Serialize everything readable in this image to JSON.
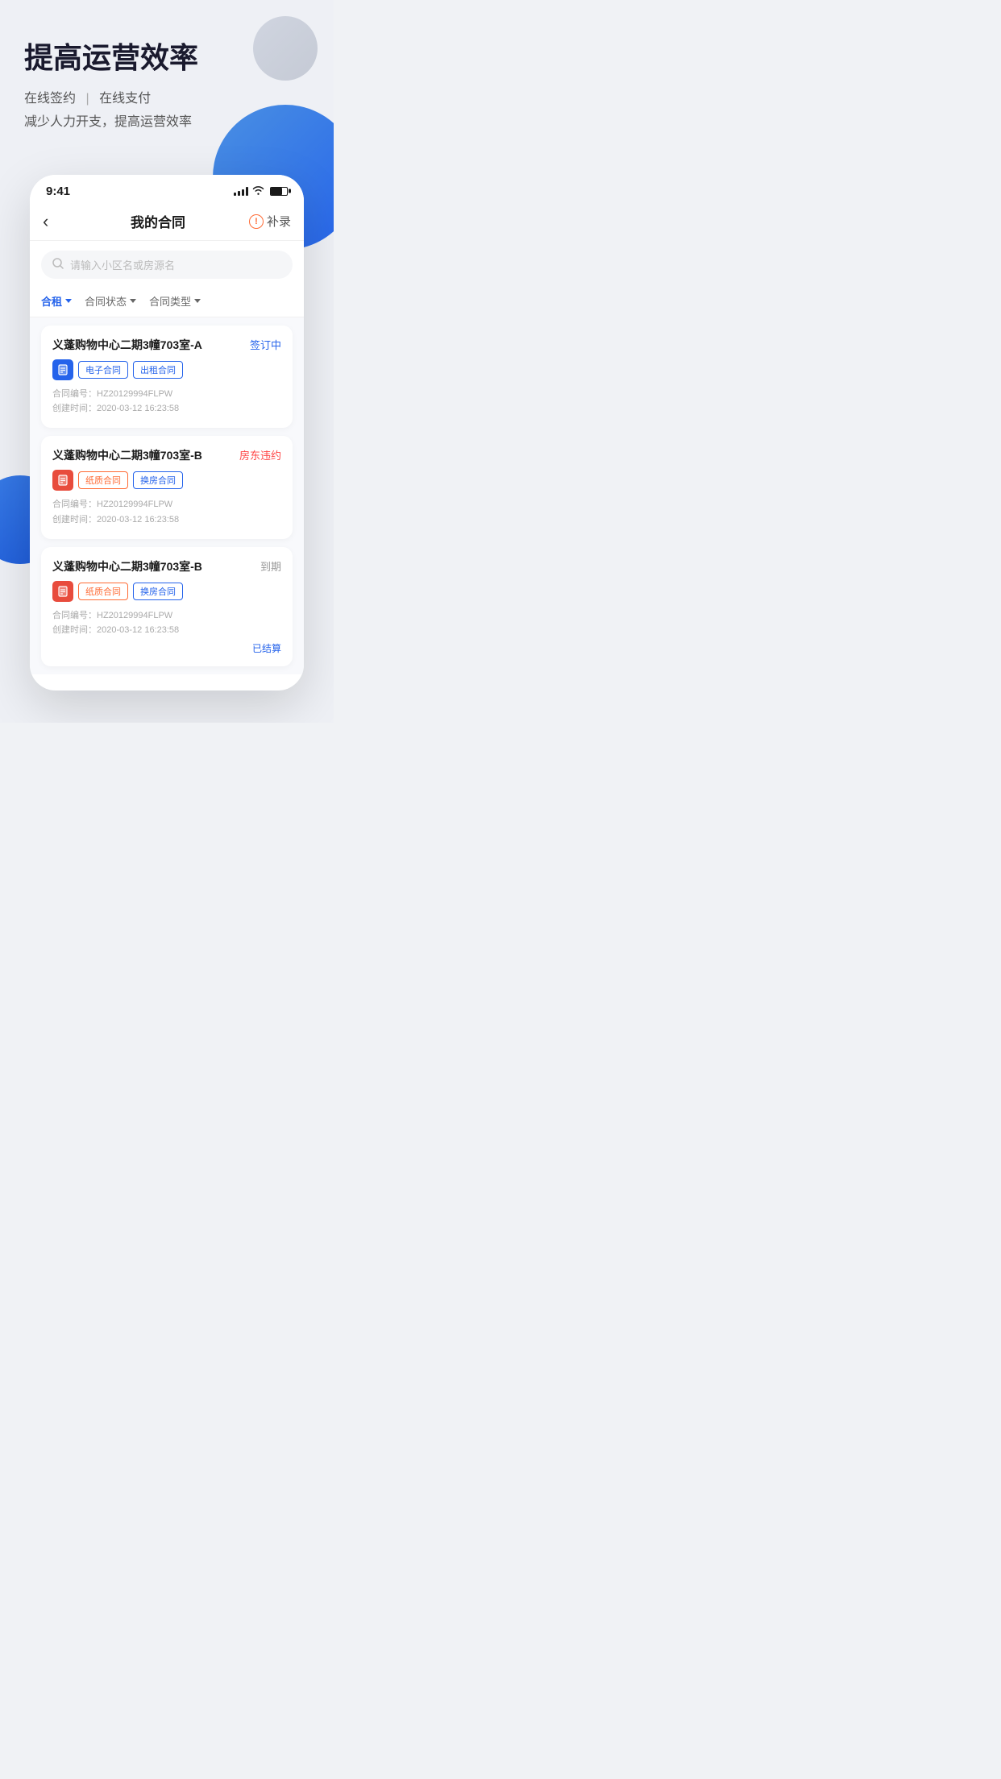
{
  "page": {
    "background": "#eef0f5"
  },
  "hero": {
    "title": "提高运营效率",
    "subtitle_line1_part1": "在线签约",
    "subtitle_line1_divider": "|",
    "subtitle_line1_part2": "在线支付",
    "subtitle_line2": "减少人力开支，提高运营效率"
  },
  "phone": {
    "status_bar": {
      "time": "9:41"
    },
    "nav": {
      "back_icon": "‹",
      "title": "我的合同",
      "action_icon": "!",
      "action_text": "补录"
    },
    "search": {
      "placeholder": "请输入小区名或房源名"
    },
    "filters": [
      {
        "label": "合租",
        "active": true
      },
      {
        "label": "合同状态",
        "active": false
      },
      {
        "label": "合同类型",
        "active": false
      }
    ],
    "contracts": [
      {
        "title": "义蓬购物中心二期3幢703室-A",
        "status": "签订中",
        "status_type": "signing",
        "icon_type": "blue",
        "tags": [
          {
            "label": "电子合同",
            "color": "blue"
          },
          {
            "label": "出租合同",
            "color": "blue"
          }
        ],
        "contract_no_label": "合同编号：",
        "contract_no": "HZ20129994FLPW",
        "created_label": "创建时间：",
        "created_time": "2020-03-12 16:23:58",
        "settled": false
      },
      {
        "title": "义蓬购物中心二期3幢703室-B",
        "status": "房东违约",
        "status_type": "violation",
        "icon_type": "red",
        "tags": [
          {
            "label": "纸质合同",
            "color": "orange"
          },
          {
            "label": "换房合同",
            "color": "blue"
          }
        ],
        "contract_no_label": "合同编号：",
        "contract_no": "HZ20129994FLPW",
        "created_label": "创建时间：",
        "created_time": "2020-03-12 16:23:58",
        "settled": false
      },
      {
        "title": "义蓬购物中心二期3幢703室-B",
        "status": "到期",
        "status_type": "expired",
        "icon_type": "red",
        "tags": [
          {
            "label": "纸质合同",
            "color": "orange"
          },
          {
            "label": "换房合同",
            "color": "blue"
          }
        ],
        "contract_no_label": "合同编号：",
        "contract_no": "HZ20129994FLPW",
        "created_label": "创建时间：",
        "created_time": "2020-03-12 16:23:58",
        "settled": true,
        "settled_label": "已结算"
      }
    ]
  }
}
